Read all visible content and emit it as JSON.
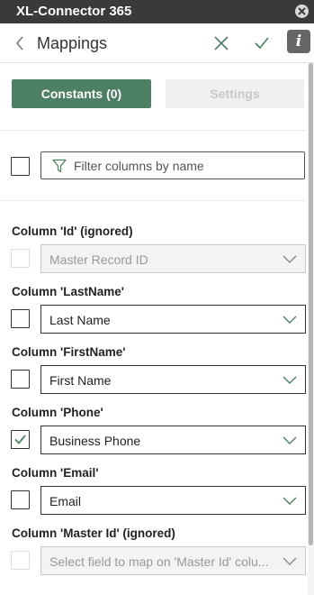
{
  "window": {
    "title": "XL-Connector 365"
  },
  "header": {
    "title": "Mappings",
    "info_label": "i"
  },
  "tabs": {
    "constants_label": "Constants (0)",
    "settings_label": "Settings"
  },
  "filter": {
    "placeholder": "Filter columns by name"
  },
  "mappings": [
    {
      "label": "Column 'Id' (ignored)",
      "value": "Master Record ID",
      "checked": false,
      "disabled": true
    },
    {
      "label": "Column 'LastName'",
      "value": "Last Name",
      "checked": false,
      "disabled": false
    },
    {
      "label": "Column 'FirstName'",
      "value": "First Name",
      "checked": false,
      "disabled": false
    },
    {
      "label": "Column 'Phone'",
      "value": "Business Phone",
      "checked": true,
      "disabled": false
    },
    {
      "label": "Column 'Email'",
      "value": "Email",
      "checked": false,
      "disabled": false
    },
    {
      "label": "Column 'Master Id' (ignored)",
      "value": "Select field to map on 'Master Id' colu...",
      "checked": false,
      "disabled": true
    }
  ],
  "colors": {
    "accent": "#4d7f63",
    "titlebar": "#3a3a3a"
  }
}
